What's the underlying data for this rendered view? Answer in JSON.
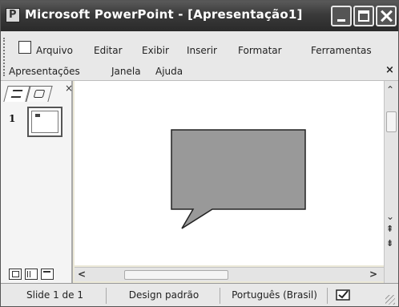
{
  "window": {
    "title": "Microsoft PowerPoint - [Apresentação1]"
  },
  "menubar": {
    "items": [
      "Arquivo",
      "Editar",
      "Exibir",
      "Inserir",
      "Formatar",
      "Ferramentas",
      "Apresentações",
      "Janela",
      "Ajuda"
    ],
    "close_glyph": "×"
  },
  "leftpane": {
    "slide_number": "1",
    "close_glyph": "×"
  },
  "statusbar": {
    "slide": "Slide 1 de 1",
    "design": "Design padrão",
    "language": "Português (Brasil)"
  },
  "slide": {
    "shape": "rectangular-callout",
    "fill": "#999999",
    "stroke": "#222222"
  },
  "icons": {
    "app": "powerpoint-icon",
    "minimize": "minimize-icon",
    "maximize": "maximize-icon",
    "close": "close-icon"
  }
}
